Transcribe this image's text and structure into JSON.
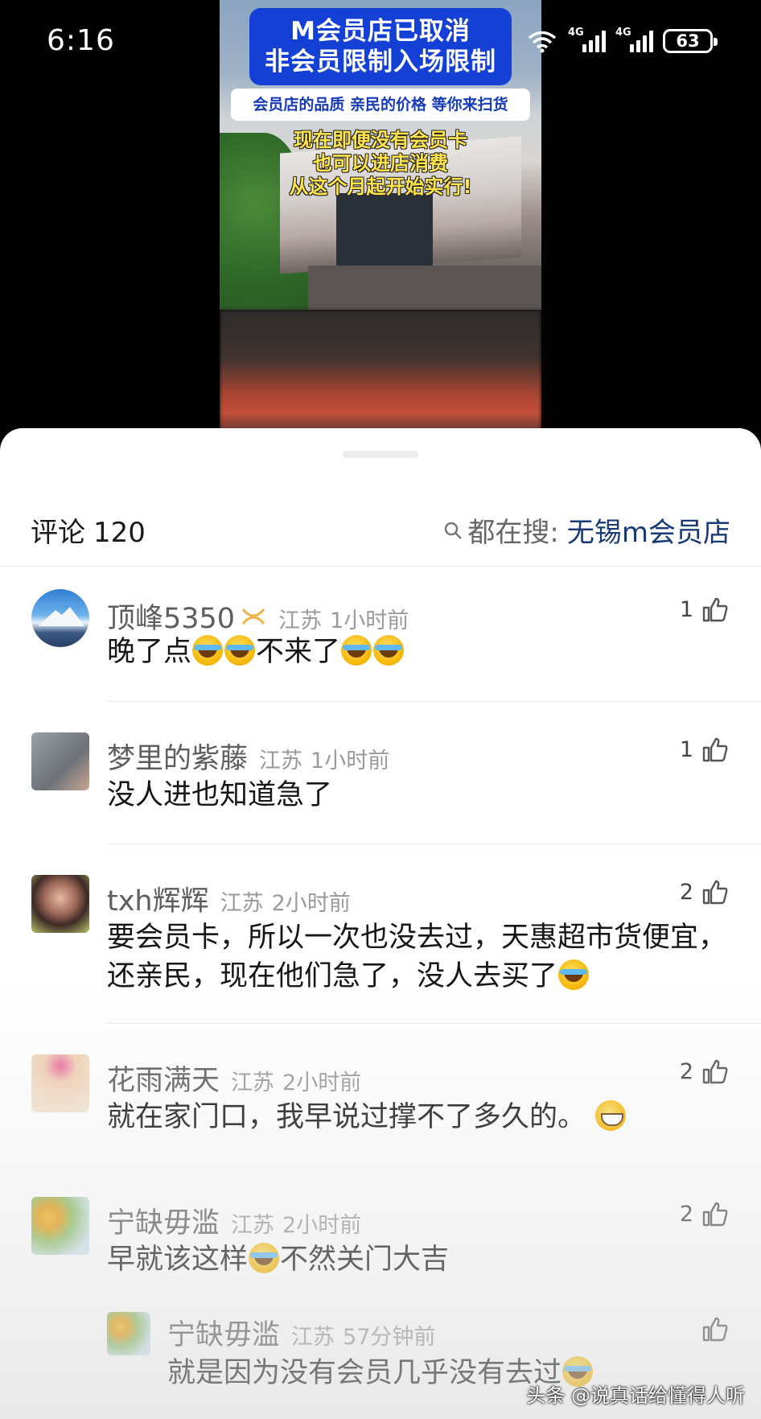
{
  "status_bar": {
    "time": "6:16",
    "battery": "63",
    "sim1": "4G",
    "sim2": "4G"
  },
  "video": {
    "banner_line1": "M会员店已取消",
    "banner_line2": "非会员限制入场限制",
    "subtitle": "会员店的品质 亲民的价格 等你来扫货",
    "caption_line1": "现在即便没有会员卡",
    "caption_line2": "也可以进店消费",
    "caption_line3": "从这个月起开始实行!"
  },
  "comments_header": {
    "label": "评论",
    "count": "120",
    "search_prefix": "都在搜:",
    "search_keyword": "无锡m会员店"
  },
  "comments": [
    {
      "name": "顶峰5350",
      "location": "江苏",
      "time": "1小时前",
      "likes": "1",
      "text_a": "晚了点",
      "text_b": "不来了"
    },
    {
      "name": "梦里的紫藤",
      "location": "江苏",
      "time": "1小时前",
      "likes": "1",
      "text": "没人进也知道急了"
    },
    {
      "name": "txh辉辉",
      "location": "江苏",
      "time": "2小时前",
      "likes": "2",
      "text_line1": "要会员卡，所以一次也没去过，天惠超市货便宜，",
      "text_line2": "还亲民，现在他们急了，没人去买了"
    },
    {
      "name": "花雨满天",
      "location": "江苏",
      "time": "2小时前",
      "likes": "2",
      "text": "就在家门口，我早说过撑不了多久的。"
    },
    {
      "name": "宁缺毋滥",
      "location": "江苏",
      "time": "2小时前",
      "likes": "2",
      "text_a": "早就该这样",
      "text_b": "不然关门大吉"
    }
  ],
  "reply": {
    "name": "宁缺毋滥",
    "location": "江苏",
    "time": "57分钟前",
    "text": "就是因为没有会员几乎没有去过"
  },
  "watermark": "头条 @说真话给懂得人听",
  "colors": {
    "banner_blue": "#1440d6",
    "caption_yellow": "#ffe44a",
    "keyword_blue": "#1a3a76"
  }
}
